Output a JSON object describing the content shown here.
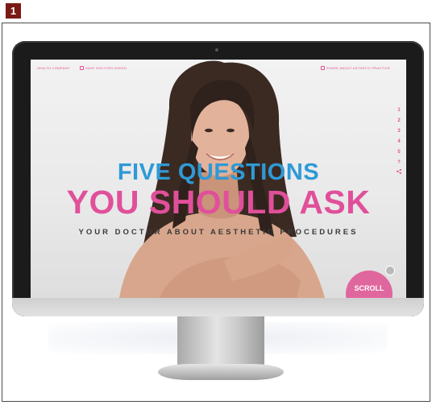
{
  "figure": {
    "badge_number": "1"
  },
  "site": {
    "topbar": {
      "left_link": "HEALTH COMPANY",
      "center_link": "HAVE DOCTORS ASKED",
      "right_link": "SHARE ABOUT ASTHETIC PRACTICE"
    },
    "side_nav": [
      "1",
      "2",
      "3",
      "4",
      "5",
      "?"
    ],
    "headline_line1": "FIVE QUESTIONS",
    "headline_line2": "YOU SHOULD ASK",
    "subheadline": "YOUR DOCTOR ABOUT AESTHETIC PROCEDURES",
    "scroll_button": "SCROLL",
    "colors": {
      "blue": "#2e9ad6",
      "pink": "#e0509a",
      "scroll_pink": "#e0669e"
    }
  },
  "icons": [
    "share-icon",
    "email-icon",
    "photo-icon"
  ]
}
